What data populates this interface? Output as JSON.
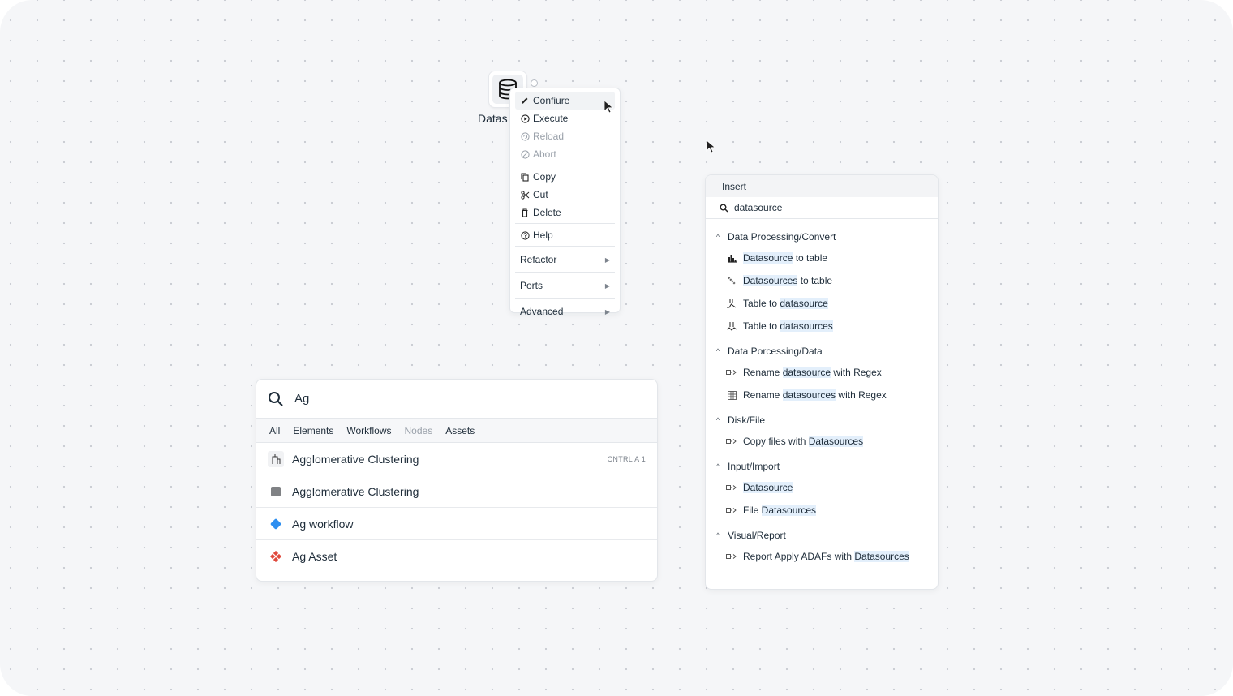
{
  "canvas": {
    "background": "#f5f6f8",
    "dot_color": "#c9ccd2"
  },
  "node": {
    "label": "Datas",
    "icon": "database-icon"
  },
  "context_menu": {
    "items": [
      {
        "label": "Confiure",
        "icon": "pencil-icon",
        "state": "hover"
      },
      {
        "label": "Execute",
        "icon": "play-circle-icon",
        "state": "enabled"
      },
      {
        "label": "Reload",
        "icon": "reload-icon",
        "state": "disabled"
      },
      {
        "label": "Abort",
        "icon": "abort-icon",
        "state": "disabled"
      },
      {
        "label": "Copy",
        "icon": "copy-icon",
        "state": "enabled"
      },
      {
        "label": "Cut",
        "icon": "scissors-icon",
        "state": "enabled"
      },
      {
        "label": "Delete",
        "icon": "trash-icon",
        "state": "enabled"
      },
      {
        "label": "Help",
        "icon": "help-icon",
        "state": "enabled"
      }
    ],
    "submenus": [
      {
        "label": "Refactor",
        "icon": "triangle-right-icon"
      },
      {
        "label": "Ports",
        "icon": "triangle-right-icon"
      },
      {
        "label": "Advanced",
        "icon": "triangle-right-icon"
      }
    ]
  },
  "insert_panel": {
    "title": "Insert",
    "search_value": "datasource",
    "highlight_color": "#e3effb",
    "categories": [
      {
        "label": "Data Processing/Convert",
        "items": [
          {
            "pre": "",
            "match": "Datasource",
            "post": " to table",
            "icon": "histogram-icon"
          },
          {
            "pre": "",
            "match": "Datasources",
            "post": " to table",
            "icon": "chain-icon"
          },
          {
            "pre": "Table to ",
            "match": "datasource",
            "post": "",
            "icon": "table-to-datasource-icon"
          },
          {
            "pre": "Table to ",
            "match": "datasources",
            "post": "",
            "icon": "table-to-datasources-icon"
          }
        ]
      },
      {
        "label": "Data Porcessing/Data",
        "items": [
          {
            "pre": "Rename ",
            "match": "datasource",
            "post": " with Regex",
            "icon": "node-port-icon"
          },
          {
            "pre": "Rename ",
            "match": "datasources",
            "post": " with Regex",
            "icon": "grid-icon"
          }
        ]
      },
      {
        "label": "Disk/File",
        "items": [
          {
            "pre": "Copy files with ",
            "match": "Datasources",
            "post": "",
            "icon": "node-port-icon"
          }
        ]
      },
      {
        "label": "Input/Import",
        "items": [
          {
            "pre": "",
            "match": "Datasource",
            "post": "",
            "icon": "node-port-icon"
          },
          {
            "pre": "File ",
            "match": "Datasources",
            "post": "",
            "icon": "node-port-icon"
          }
        ]
      },
      {
        "label": "Visual/Report",
        "items": [
          {
            "pre": "Report Apply ADAFs with ",
            "match": "Datasources",
            "post": "",
            "icon": "node-port-icon"
          }
        ]
      }
    ]
  },
  "search_panel": {
    "query": "Ag",
    "filters": [
      {
        "label": "All",
        "disabled": false
      },
      {
        "label": "Elements",
        "disabled": false
      },
      {
        "label": "Workflows",
        "disabled": false
      },
      {
        "label": "Nodes",
        "disabled": true
      },
      {
        "label": "Assets",
        "disabled": false
      }
    ],
    "results": [
      {
        "label": "Agglomerative Clustering",
        "icon": "clustering-node-icon",
        "shortcut": "CNTRL A 1"
      },
      {
        "label": "Agglomerative Clustering",
        "icon": "gray-square-icon",
        "shortcut": ""
      },
      {
        "label": "Ag workflow",
        "icon": "blue-diamond-icon",
        "shortcut": ""
      },
      {
        "label": "Ag Asset",
        "icon": "red-asset-icon",
        "shortcut": ""
      }
    ],
    "colors": {
      "workflow": "#2e8ff0",
      "asset": "#e0493c",
      "element": "#808285"
    }
  }
}
